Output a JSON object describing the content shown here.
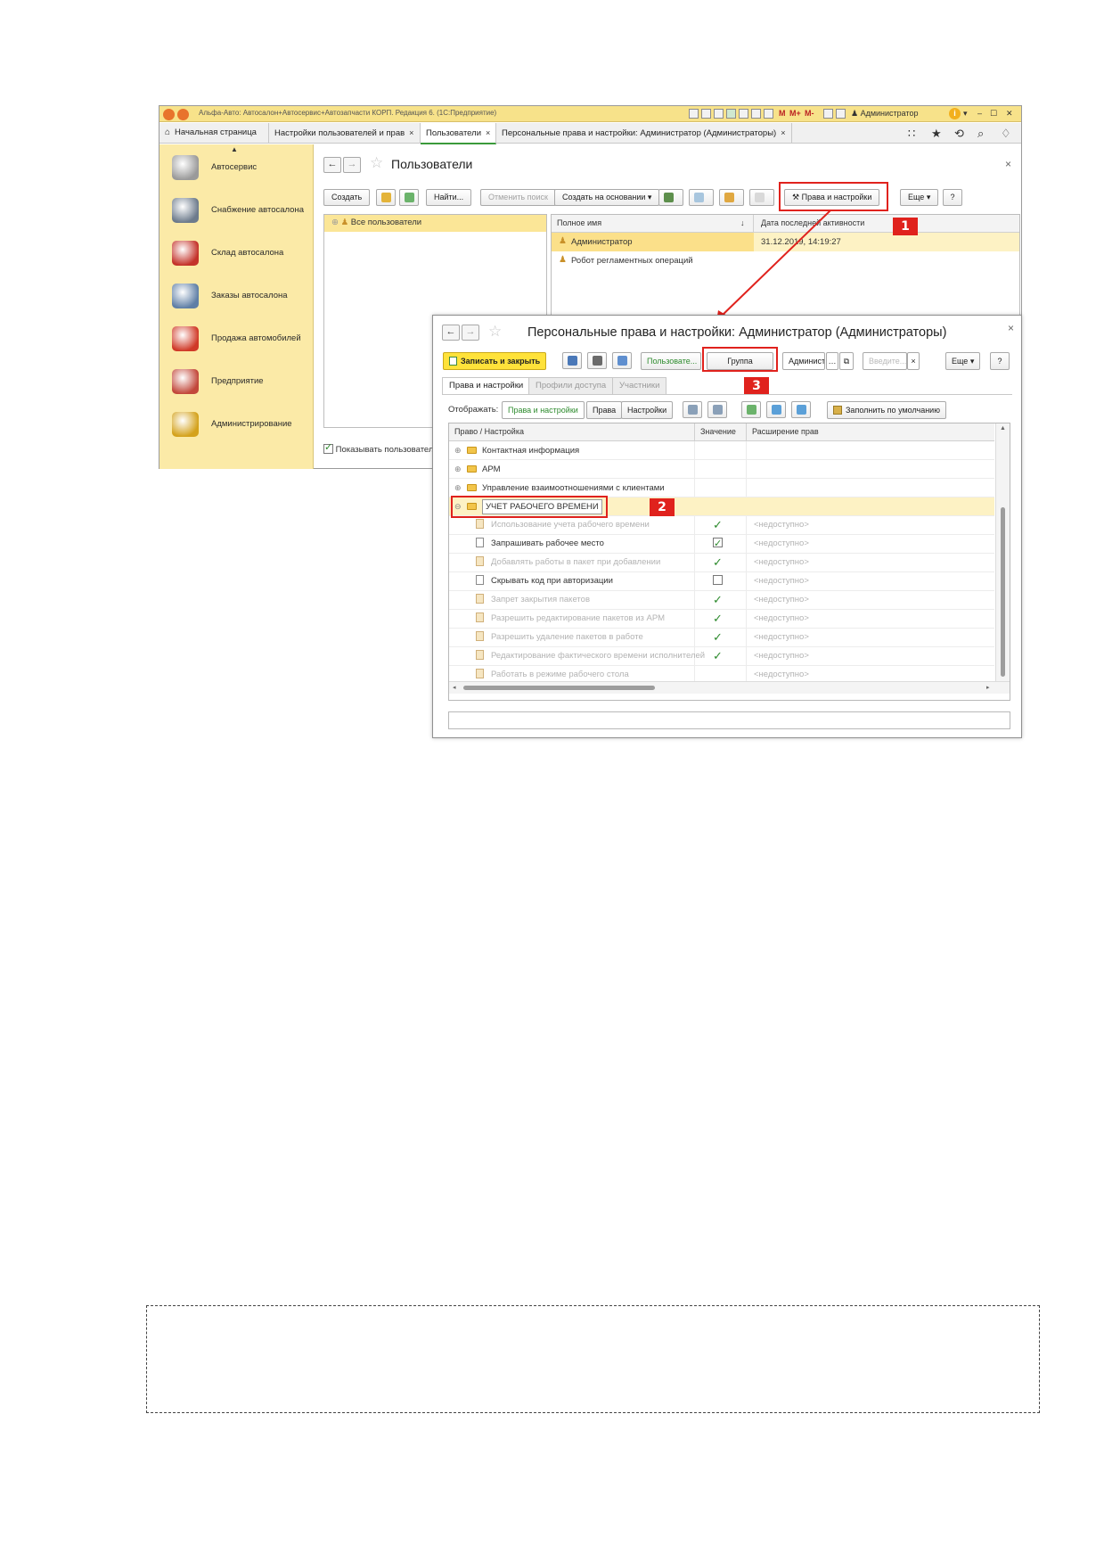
{
  "titlebar": {
    "title": "Альфа-Авто: Автосалон+Автосервис+Автозапчасти КОРП. Редакция 6. (1С:Предприятие)",
    "memory_buttons": [
      "M",
      "M+",
      "M-"
    ],
    "user": "Администратор"
  },
  "tabs": [
    {
      "label": "Начальная страница"
    },
    {
      "label": "Настройки пользователей и прав",
      "close": "×"
    },
    {
      "label": "Пользователи",
      "close": "×"
    },
    {
      "label": "Персональные права и настройки: Администратор (Администраторы)",
      "close": "×"
    }
  ],
  "sidebar": {
    "items": [
      {
        "label": "Автосервис",
        "icon": "wheel-icon",
        "color": "#9a9a9a"
      },
      {
        "label": "Снабжение автосалона",
        "icon": "calculator-icon",
        "color": "#6d7b8c"
      },
      {
        "label": "Склад автосалона",
        "icon": "garage-icon",
        "color": "#c4332a"
      },
      {
        "label": "Заказы автосалона",
        "icon": "clerk-icon",
        "color": "#5f7fa6"
      },
      {
        "label": "Продажа автомобилей",
        "icon": "car-icon",
        "color": "#d03a28"
      },
      {
        "label": "Предприятие",
        "icon": "building-icon",
        "color": "#c2483b"
      },
      {
        "label": "Администрирование",
        "icon": "database-icon",
        "color": "#d4a21c"
      }
    ],
    "scroll_up": "▲"
  },
  "users": {
    "nav_back": "←",
    "nav_forward": "→",
    "star": "☆",
    "title": "Пользователи",
    "close": "×",
    "buttons": {
      "create": "Создать",
      "find": "Найти...",
      "cancel_search": "Отменить поиск",
      "create_basis": "Создать на основании",
      "rights": "Права и настройки",
      "more": "Еще",
      "help": "?"
    },
    "tree_root": "Все пользователи",
    "columns": [
      "Полное имя",
      "↓",
      "Дата последней активности"
    ],
    "rows": [
      {
        "name": "Администратор",
        "date": "31.12.2019, 14:19:27"
      },
      {
        "name": "Робот регламентных операций",
        "date": ""
      }
    ],
    "show_checkbox": "Показывать пользователе"
  },
  "dialog": {
    "nav_back": "←",
    "nav_forward": "→",
    "star": "☆",
    "title": "Персональные права и настройки: Администратор (Администраторы)",
    "close": "×",
    "toolbar": {
      "save_close": "Записать и закрыть",
      "user_btn": "Пользовате...",
      "group_btn": "Группа",
      "admin_field": "Администр",
      "search_placeholder": "Введите...",
      "clear": "×",
      "more": "Еще",
      "help": "?"
    },
    "tabs": [
      "Права и настройки",
      "Профили доступа",
      "Участники"
    ],
    "display": {
      "label": "Отображать:",
      "options": [
        "Права и настройки",
        "Права",
        "Настройки"
      ],
      "fill_default": "Заполнить по умолчанию"
    },
    "columns": [
      "Право / Настройка",
      "Значение",
      "Расширение прав"
    ],
    "groups": [
      "Контактная информация",
      "АРМ",
      "Управление взаимоотношениями с клиентами"
    ],
    "edited_group": "УЧЕТ РАБОЧЕГО ВРЕМЕНИ",
    "unavailable": "<недоступно>",
    "rows": [
      {
        "label": "Использование учета рабочего времени",
        "value": "check",
        "enabled": false
      },
      {
        "label": "Запрашивать рабочее место",
        "value": "checkbox-checked",
        "enabled": true
      },
      {
        "label": "Добавлять работы в пакет при добавлении",
        "value": "check",
        "enabled": false
      },
      {
        "label": "Скрывать код при авторизации",
        "value": "checkbox-empty",
        "enabled": true
      },
      {
        "label": "Запрет закрытия пакетов",
        "value": "check",
        "enabled": false
      },
      {
        "label": "Разрешить редактирование пакетов из АРМ",
        "value": "check",
        "enabled": false
      },
      {
        "label": "Разрешить удаление пакетов в работе",
        "value": "check",
        "enabled": false
      },
      {
        "label": "Редактирование фактического времени исполнителей",
        "value": "check",
        "enabled": false
      },
      {
        "label": "Работать в режиме рабочего стола",
        "value": "",
        "enabled": false
      }
    ]
  },
  "annotations": {
    "badge1": "1",
    "badge2": "2",
    "badge3": "3",
    "color": "#e0221d"
  }
}
